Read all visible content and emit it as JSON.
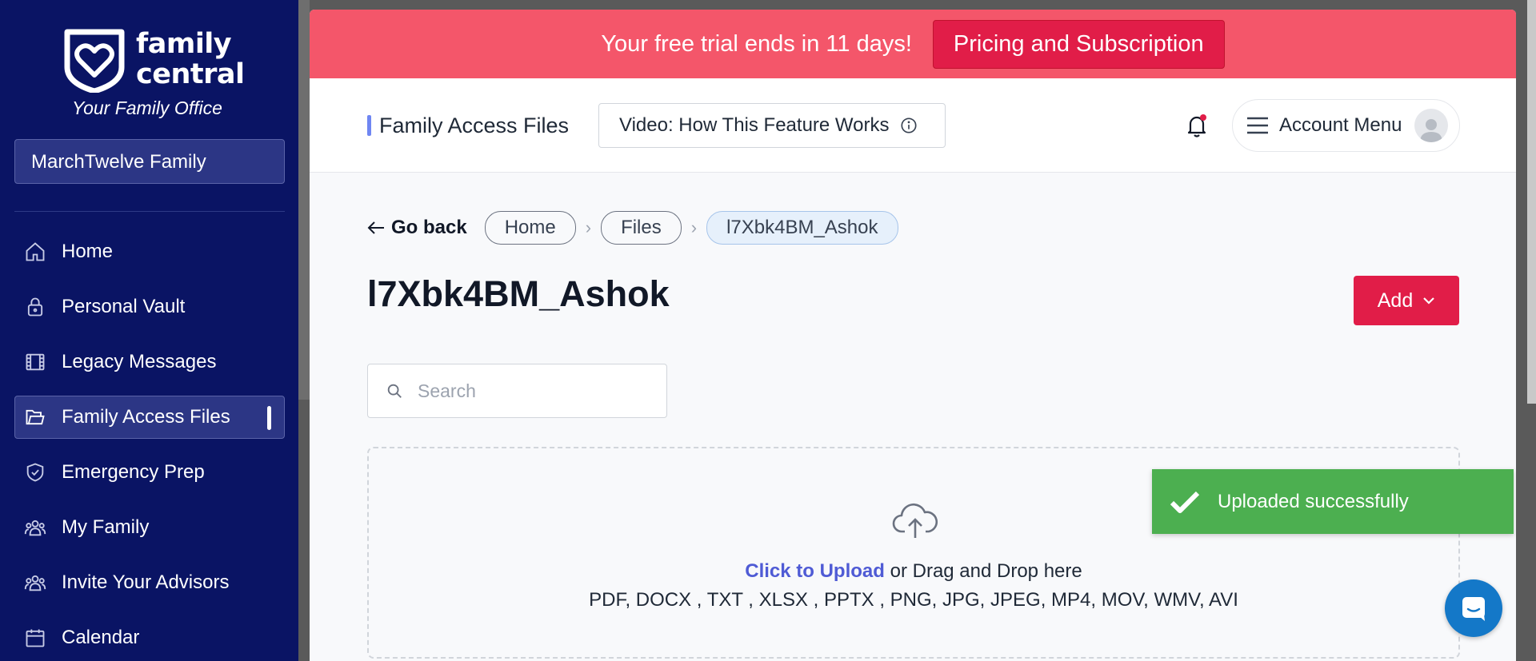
{
  "brand": {
    "name": "family central",
    "tagline": "Your Family Office"
  },
  "sidebar": {
    "family_selector": "MarchTwelve Family",
    "items": [
      {
        "label": "Home",
        "icon": "home-icon"
      },
      {
        "label": "Personal Vault",
        "icon": "lock-icon"
      },
      {
        "label": "Legacy Messages",
        "icon": "film-icon"
      },
      {
        "label": "Family Access Files",
        "icon": "folder-icon",
        "active": true
      },
      {
        "label": "Emergency Prep",
        "icon": "shield-icon"
      },
      {
        "label": "My Family",
        "icon": "people-icon"
      },
      {
        "label": "Invite Your Advisors",
        "icon": "people-icon"
      },
      {
        "label": "Calendar",
        "icon": "calendar-icon"
      }
    ]
  },
  "banner": {
    "text": "Your free trial ends in 11 days!",
    "button": "Pricing and Subscription"
  },
  "header": {
    "page_tag": "Family Access Files",
    "video_button": "Video: How This Feature Works",
    "account_menu": "Account Menu"
  },
  "breadcrumb": {
    "go_back": "Go back",
    "items": [
      "Home",
      "Files",
      "l7Xbk4BM_Ashok"
    ]
  },
  "main": {
    "title": "l7Xbk4BM_Ashok",
    "add_button": "Add",
    "search_placeholder": "Search"
  },
  "dropzone": {
    "link": "Click to Upload",
    "rest": " or Drag and Drop here",
    "formats": "PDF, DOCX , TXT , XLSX , PPTX , PNG, JPG, JPEG, MP4, MOV, WMV, AVI"
  },
  "toast": {
    "message": "Uploaded successfully"
  },
  "colors": {
    "sidebar": "#0a1464",
    "banner": "#f4566a",
    "accent_red": "#e11d48",
    "toast": "#4caf50",
    "link": "#4f5bd5"
  }
}
